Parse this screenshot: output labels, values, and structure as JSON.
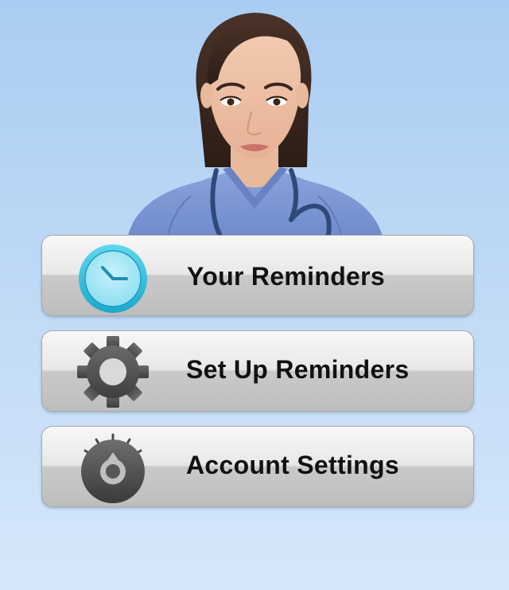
{
  "hero": {
    "image": "nurse-illustration"
  },
  "menu": {
    "items": [
      {
        "label": "Your Reminders",
        "icon": "clock-icon"
      },
      {
        "label": "Set Up Reminders",
        "icon": "gear-icon"
      },
      {
        "label": "Account Settings",
        "icon": "dial-icon"
      }
    ]
  },
  "colors": {
    "background_top": "#a9cdf2",
    "background_bottom": "#d6e7fa",
    "clock_accent": "#35c6e6",
    "scrubs": "#7f9ad6",
    "button_text": "#111111"
  }
}
